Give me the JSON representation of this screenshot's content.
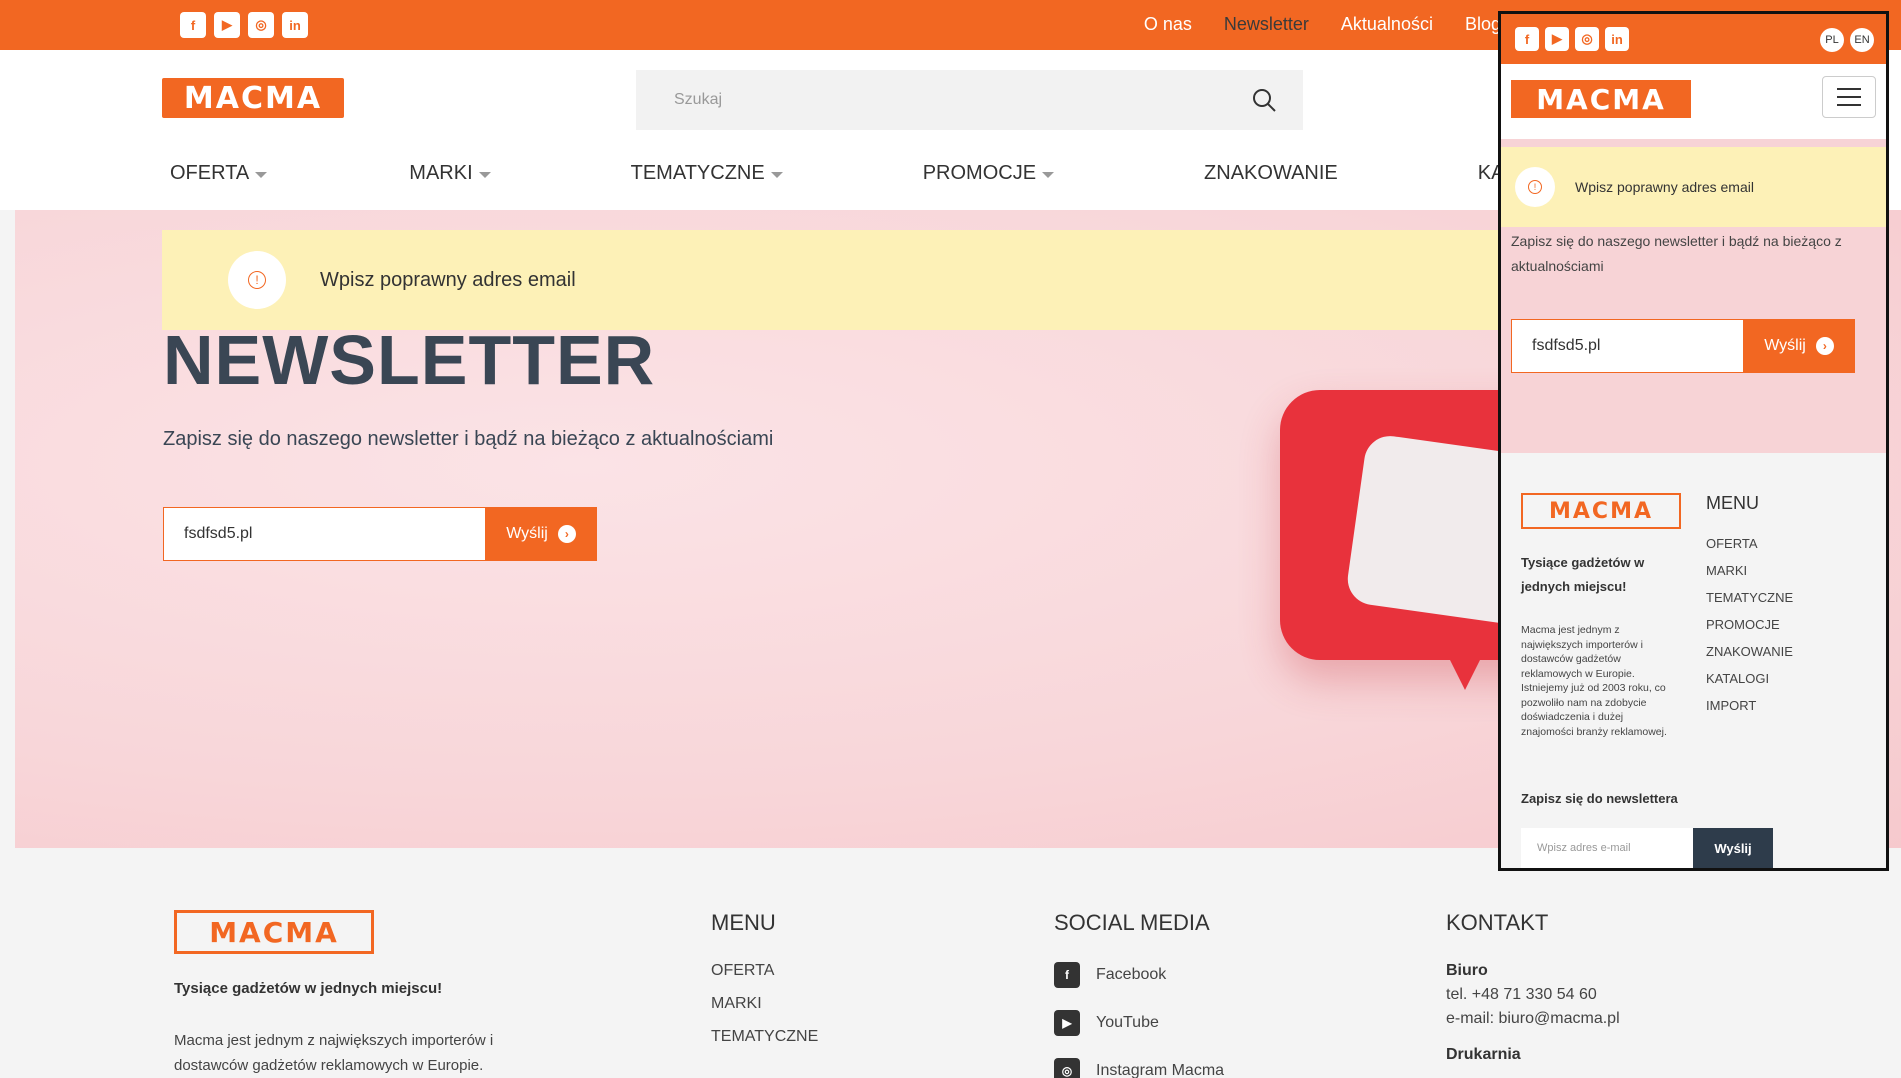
{
  "top_bar": {
    "social": [
      "facebook-icon",
      "youtube-icon",
      "instagram-icon",
      "linkedin-icon"
    ],
    "nav": [
      {
        "label": "O nas"
      },
      {
        "label": "Newsletter"
      },
      {
        "label": "Aktualności"
      },
      {
        "label": "Blog"
      }
    ]
  },
  "header": {
    "logo_text": "MACMA",
    "search_placeholder": "Szukaj",
    "nav": [
      {
        "label": "OFERTA"
      },
      {
        "label": "MARKI"
      },
      {
        "label": "TEMATYCZNE"
      },
      {
        "label": "PROMOCJE"
      },
      {
        "label": "ZNAKOWANIE"
      },
      {
        "label": "KATALO"
      }
    ]
  },
  "alert": {
    "text": "Wpisz poprawny adres email"
  },
  "hero": {
    "title": "NEWSLETTER",
    "subtitle": "Zapisz się do naszego newsletter i bądź na bieżąco z aktualnościami",
    "email_value": "fsdfsd5.pl",
    "submit_label": "Wyślij"
  },
  "footer": {
    "logo_text": "MACMA",
    "tagline": "Tysiące gadżetów w jednych miejscu!",
    "description": "Macma jest jednym z największych importerów i dostawców gadżetów reklamowych w Europie.",
    "menu": {
      "title": "MENU",
      "items": [
        "OFERTA",
        "MARKI",
        "TEMATYCZNE"
      ]
    },
    "social": {
      "title": "SOCIAL MEDIA",
      "items": [
        "Facebook",
        "YouTube",
        "Instagram Macma"
      ]
    },
    "contact": {
      "title": "KONTAKT",
      "office_label": "Biuro",
      "phone": "tel. +48 71 330 54 60",
      "email": "e-mail: biuro@macma.pl",
      "next_label": "Drukarnia"
    }
  },
  "mobile": {
    "languages": [
      "PL",
      "EN"
    ],
    "alert_text": "Wpisz poprawny adres email",
    "subtitle": "Zapisz się do naszego newsletter i bądź na bieżąco z aktualnościami",
    "email_value": "fsdfsd5.pl",
    "submit_label": "Wyślij",
    "footer": {
      "tagline": "Tysiące gadżetów w jednych miejscu!",
      "description": "Macma jest jednym z największych importerów i dostawców gadżetów reklamowych w Europie. Istniejemy już od 2003 roku, co pozwoliło nam na zdobycie doświadczenia i dużej znajomości branży reklamowej.",
      "menu_title": "MENU",
      "menu_items": [
        "OFERTA",
        "MARKI",
        "TEMATYCZNE",
        "PROMOCJE",
        "ZNAKOWANIE",
        "KATALOGI",
        "IMPORT"
      ],
      "newsletter_title": "Zapisz się do newslettera",
      "newsletter_placeholder": "Wpisz adres e-mail",
      "newsletter_button": "Wyślij"
    }
  },
  "colors": {
    "brand_orange": "#f26722",
    "alert_yellow": "#fdf1b7",
    "hero_pink": "#f8d6d9",
    "dark_button": "#2e3c4b"
  }
}
